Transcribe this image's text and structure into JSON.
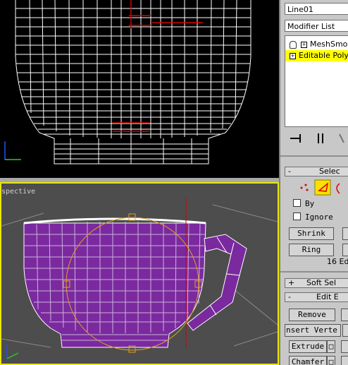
{
  "viewports": {
    "top_view": {
      "label": ""
    },
    "perspective": {
      "label": "spective"
    }
  },
  "panel": {
    "object_name": "Line01",
    "modifier_list": "Modifier List",
    "stack": [
      {
        "label": "MeshSmo",
        "selected": false
      },
      {
        "label": "Editable Poly",
        "selected": true
      }
    ],
    "selection": {
      "header": "Selec",
      "by_label": "By",
      "ignore_label": "Ignore",
      "shrink_label": "Shrink",
      "ring_label": "Ring",
      "status": "16 Ed"
    },
    "soft_selection": {
      "header": "Soft Sel"
    },
    "edit_edges": {
      "header": "Edit E",
      "remove_label": "Remove",
      "insert_vertex_label": "nsert Verte",
      "extrude_label": "Extrude",
      "chamfer_label": "Chamfer"
    }
  },
  "colors": {
    "cup": "#7a2a9e",
    "wire_top": "#ffffff",
    "selection_red": "#d40000",
    "gizmo_orange": "#e0a020",
    "stack_highlight": "#ffff00",
    "viewport_border_active": "#e8e800"
  }
}
